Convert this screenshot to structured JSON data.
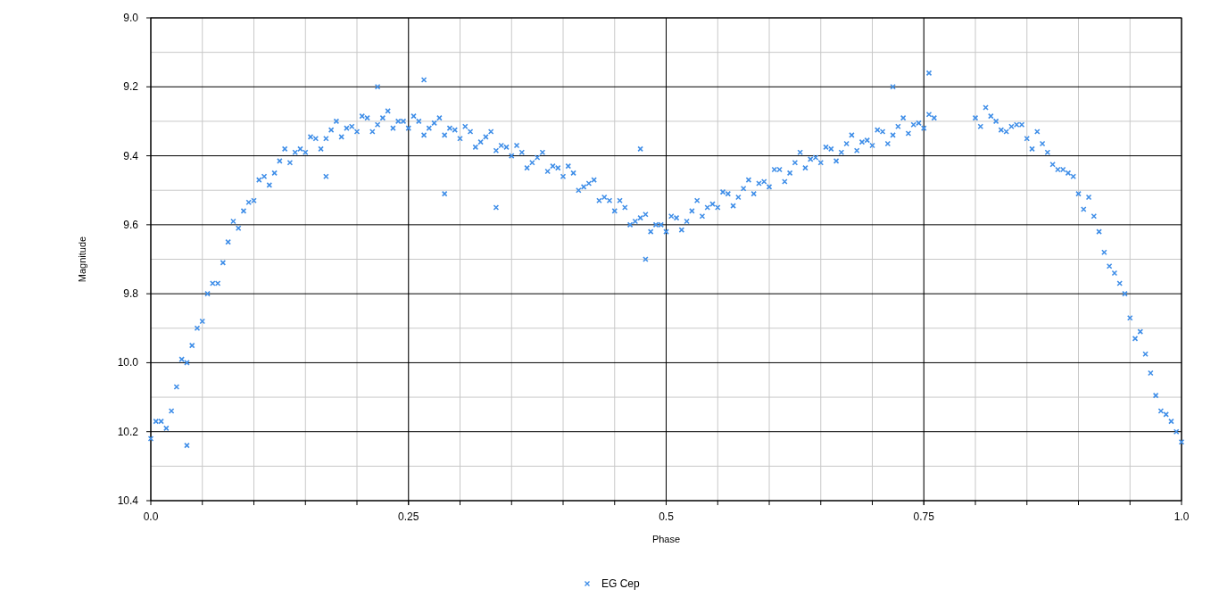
{
  "chart_data": {
    "type": "scatter",
    "grid": true,
    "xlabel": "Phase",
    "ylabel": "Magnitude",
    "xlim": [
      0,
      1
    ],
    "ylim": [
      10.4,
      9.0
    ],
    "xticks": [
      {
        "value": 0,
        "label": "0.0"
      },
      0.25,
      0.5,
      0.75,
      {
        "value": 1,
        "label": "1.0"
      }
    ],
    "yticks": [
      {
        "value": 9,
        "label": "9.0"
      },
      9.2,
      9.4,
      9.6,
      9.8,
      {
        "value": 10,
        "label": "10.0"
      },
      10.2,
      10.4
    ],
    "x": [
      0,
      0.01,
      0.02,
      0.03,
      0.04,
      0.05,
      0.06,
      0.07,
      0.08,
      0.09,
      0.1,
      0.11,
      0.12,
      0.13,
      0.14,
      0.15,
      0.16,
      0.17,
      0.18,
      0.19,
      0.2,
      0.21,
      0.22,
      0.23,
      0.24,
      0.25,
      0.26,
      0.27,
      0.28,
      0.29,
      0.3,
      0.31,
      0.32,
      0.33,
      0.34,
      0.35,
      0.36,
      0.37,
      0.38,
      0.39,
      0.4,
      0.41,
      0.42,
      0.43,
      0.44,
      0.45,
      0.46,
      0.47,
      0.48,
      0.49,
      0.5,
      0.51,
      0.52,
      0.53,
      0.54,
      0.55,
      0.56,
      0.57,
      0.58,
      0.59,
      0.6,
      0.61,
      0.62,
      0.63,
      0.64,
      0.65,
      0.66,
      0.67,
      0.68,
      0.69,
      0.7,
      0.71,
      0.72,
      0.73,
      0.74,
      0.75,
      0.76,
      0.8,
      0.81,
      0.82,
      0.83,
      0.84,
      0.85,
      0.86,
      0.87,
      0.88,
      0.89,
      0.9,
      0.91,
      0.92,
      0.93,
      0.94,
      0.95,
      0.96,
      0.97,
      0.98,
      0.99,
      1,
      0.005,
      0.015,
      0.025,
      0.035,
      0.045,
      0.055,
      0.065,
      0.075,
      0.085,
      0.095,
      0.105,
      0.115,
      0.125,
      0.135,
      0.145,
      0.155,
      0.165,
      0.175,
      0.185,
      0.195,
      0.205,
      0.215,
      0.225,
      0.235,
      0.245,
      0.255,
      0.265,
      0.275,
      0.285,
      0.295,
      0.305,
      0.315,
      0.325,
      0.335,
      0.345,
      0.355,
      0.365,
      0.375,
      0.385,
      0.395,
      0.405,
      0.415,
      0.425,
      0.435,
      0.445,
      0.455,
      0.465,
      0.475,
      0.485,
      0.495,
      0.505,
      0.515,
      0.525,
      0.535,
      0.545,
      0.555,
      0.565,
      0.575,
      0.585,
      0.595,
      0.605,
      0.615,
      0.625,
      0.635,
      0.645,
      0.655,
      0.665,
      0.675,
      0.685,
      0.695,
      0.705,
      0.715,
      0.725,
      0.735,
      0.745,
      0.755,
      0.805,
      0.815,
      0.825,
      0.835,
      0.845,
      0.855,
      0.865,
      0.875,
      0.885,
      0.895,
      0.905,
      0.915,
      0.925,
      0.935,
      0.945,
      0.955,
      0.965,
      0.975,
      0.985,
      0.995,
      0.035,
      0.17,
      0.265,
      0.285,
      0.335,
      0.475,
      0.755,
      0.22,
      0.72,
      0.48
    ],
    "series": [
      {
        "name": "EG Cep",
        "color": "#3f8ee8",
        "values": [
          10.22,
          10.17,
          10.14,
          9.99,
          9.95,
          9.88,
          9.77,
          9.71,
          9.59,
          9.56,
          9.53,
          9.46,
          9.45,
          9.38,
          9.39,
          9.39,
          9.35,
          9.35,
          9.3,
          9.32,
          9.33,
          9.29,
          9.31,
          9.27,
          9.3,
          9.32,
          9.3,
          9.32,
          9.29,
          9.32,
          9.35,
          9.33,
          9.36,
          9.33,
          9.37,
          9.4,
          9.39,
          9.42,
          9.39,
          9.43,
          9.46,
          9.45,
          9.49,
          9.47,
          9.52,
          9.56,
          9.55,
          9.59,
          9.57,
          9.6,
          9.62,
          9.58,
          9.59,
          9.53,
          9.55,
          9.55,
          9.51,
          9.52,
          9.47,
          9.48,
          9.49,
          9.44,
          9.45,
          9.39,
          9.41,
          9.42,
          9.38,
          9.39,
          9.34,
          9.36,
          9.37,
          9.33,
          9.34,
          9.29,
          9.31,
          9.32,
          9.29,
          9.29,
          9.26,
          9.3,
          9.33,
          9.31,
          9.35,
          9.33,
          9.39,
          9.44,
          9.45,
          9.51,
          9.52,
          9.62,
          9.72,
          9.77,
          9.87,
          9.91,
          10.03,
          10.14,
          10.17,
          10.23,
          10.17,
          10.19,
          10.07,
          10,
          9.9,
          9.8,
          9.77,
          9.65,
          9.61,
          9.535,
          9.47,
          9.485,
          9.415,
          9.42,
          9.38,
          9.345,
          9.38,
          9.325,
          9.345,
          9.315,
          9.285,
          9.33,
          9.29,
          9.32,
          9.3,
          9.285,
          9.34,
          9.305,
          9.34,
          9.325,
          9.315,
          9.375,
          9.345,
          9.385,
          9.375,
          9.37,
          9.435,
          9.405,
          9.445,
          9.435,
          9.43,
          9.5,
          9.48,
          9.53,
          9.53,
          9.53,
          9.6,
          9.58,
          9.62,
          9.6,
          9.575,
          9.615,
          9.56,
          9.575,
          9.54,
          9.505,
          9.545,
          9.495,
          9.51,
          9.475,
          9.44,
          9.475,
          9.42,
          9.435,
          9.405,
          9.375,
          9.415,
          9.365,
          9.385,
          9.355,
          9.325,
          9.365,
          9.315,
          9.335,
          9.305,
          9.28,
          9.315,
          9.285,
          9.325,
          9.315,
          9.31,
          9.38,
          9.365,
          9.425,
          9.44,
          9.46,
          9.555,
          9.575,
          9.68,
          9.74,
          9.8,
          9.93,
          9.975,
          10.095,
          10.15,
          10.2,
          10.24,
          9.46,
          9.18,
          9.51,
          9.55,
          9.38,
          9.16,
          9.2,
          9.2,
          9.7
        ]
      }
    ]
  }
}
